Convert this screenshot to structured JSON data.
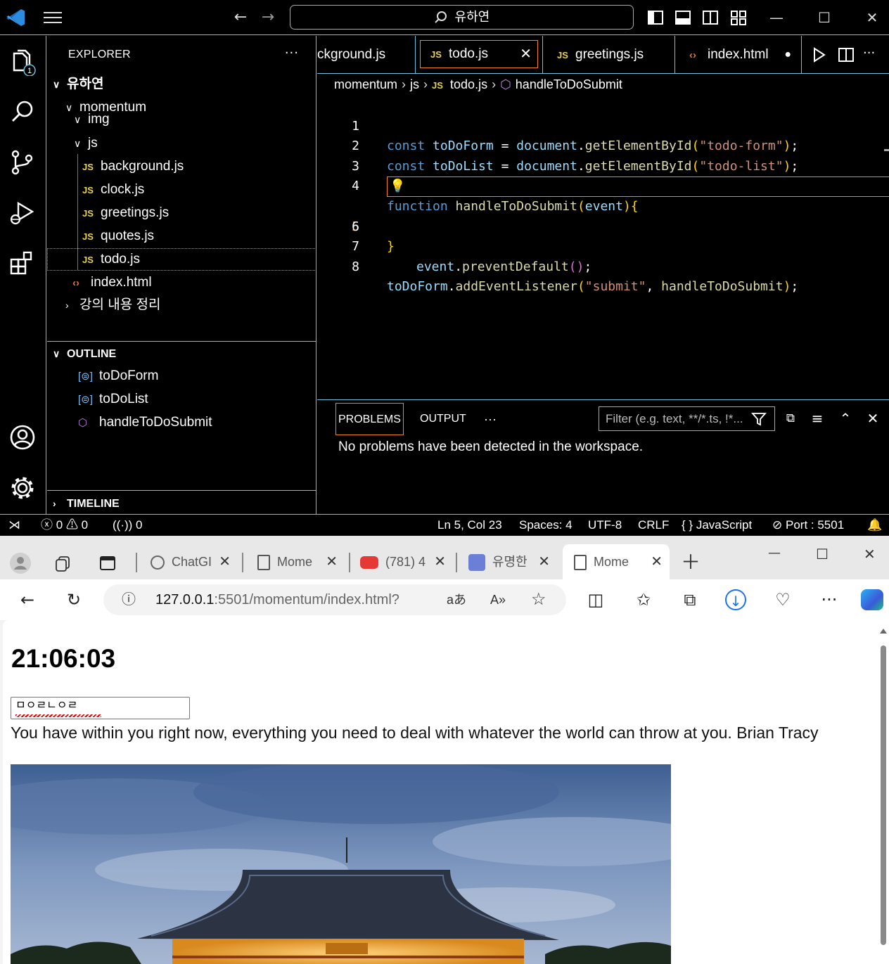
{
  "vscode": {
    "search_text": "유하연",
    "explorer": {
      "title": "EXPLORER",
      "more": "···",
      "root": "유하연",
      "folder_momentum": "momentum",
      "folder_img": "img",
      "folder_js": "js",
      "files": [
        "background.js",
        "clock.js",
        "greetings.js",
        "quotes.js",
        "todo.js"
      ],
      "js_badge": "JS",
      "index_html": "index.html",
      "folder_notes": "강의 내용 정리"
    },
    "outline": {
      "title": "OUTLINE",
      "items": [
        "toDoForm",
        "toDoList",
        "handleToDoSubmit"
      ]
    },
    "timeline": "TIMELINE",
    "tabs": {
      "background": "ckground.js",
      "todo": "todo.js",
      "greetings": "greetings.js",
      "index": "index.html"
    },
    "breadcrumb": {
      "folder": "momentum",
      "sub": "js",
      "file": "todo.js",
      "symbol": "handleToDoSubmit"
    },
    "code": {
      "line_numbers": [
        "1",
        "2",
        "3",
        "4",
        "5",
        "6",
        "7",
        "8"
      ],
      "l1": {
        "kw": "const",
        "name": "toDoForm",
        "eq": " = ",
        "obj": "document",
        "dot": ".",
        "fn": "getElementById",
        "arg": "\"todo-form\"",
        "end": ";"
      },
      "l2": {
        "kw": "const",
        "name": "toDoList",
        "eq": " = ",
        "obj": "document",
        "dot": ".",
        "fn": "getElementById",
        "arg": "\"todo-list\"",
        "end": ";"
      },
      "l4": {
        "kw": "function",
        "fn": "handleToDoSubmit",
        "param": "event"
      },
      "l5": {
        "obj": "event",
        "dot": ".",
        "fn": "preventDefault"
      },
      "l8": {
        "obj": "toDoForm",
        "dot": ".",
        "fn": "addEventListener",
        "arg": "\"submit\"",
        "comma": ", ",
        "ref": "handleToDoSubmit",
        "end": ";"
      }
    },
    "panel": {
      "tab_problems": "PROBLEMS",
      "tab_output": "OUTPUT",
      "more": "···",
      "filter_placeholder": "Filter (e.g. text, **/*.ts, !*...",
      "message": "No problems have been detected in the workspace."
    },
    "status": {
      "errors": "0",
      "warnings": "0",
      "ports": "0",
      "position": "Ln 5, Col 23",
      "spaces": "Spaces: 4",
      "encoding": "UTF-8",
      "eol": "CRLF",
      "language": "JavaScript",
      "port": "Port : 5501"
    },
    "badge_count": "1"
  },
  "browser": {
    "tabs": [
      "ChatGI",
      "Mome",
      "(781) 4",
      "유명한",
      "Mome"
    ],
    "url_host": "127.0.0.1",
    "url_rest": ":5501/momentum/index.html?",
    "page": {
      "clock": "21:06:03",
      "todo_input_value": "ㅁㅇㄹㄴㅇㄹ",
      "quote": "You have within you right now, everything you need to deal with whatever the world can throw at you. Brian Tracy"
    }
  },
  "colors": {
    "accent_border": "#6fc3df",
    "active_focus": "#f38518",
    "keyword": "#569cd6",
    "variable": "#9cdcfe",
    "function": "#dcdcaa",
    "string": "#ce9178"
  }
}
